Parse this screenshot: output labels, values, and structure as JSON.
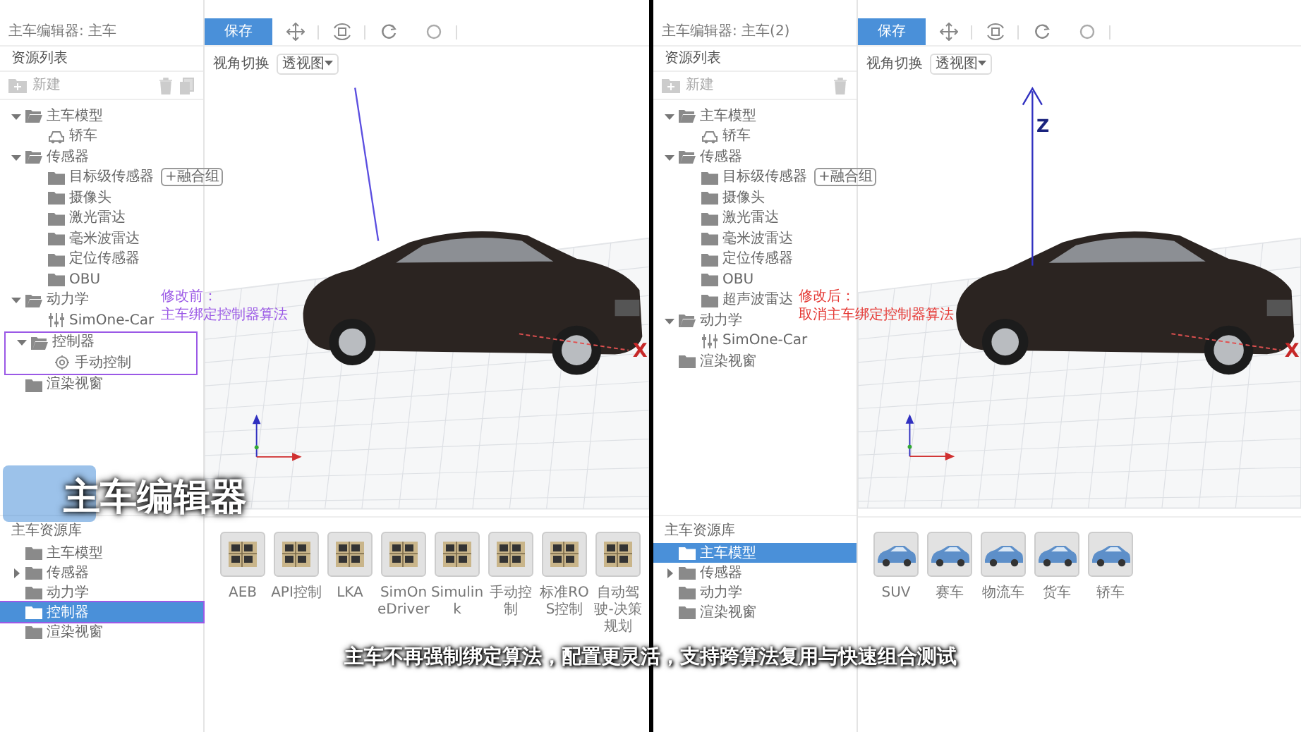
{
  "panes": [
    {
      "editor_title": "主车编辑器: 主车",
      "list_title": "资源列表",
      "new_label": "新建",
      "show_copy": true,
      "tree": [
        {
          "label": "主车模型",
          "kind": "folder",
          "expanded": true,
          "children": [
            {
              "label": "轿车",
              "kind": "car"
            }
          ]
        },
        {
          "label": "传感器",
          "kind": "folder",
          "expanded": true,
          "children": [
            {
              "label": "目标级传感器",
              "kind": "folder",
              "badge": "+融合组"
            },
            {
              "label": "摄像头",
              "kind": "folder"
            },
            {
              "label": "激光雷达",
              "kind": "folder"
            },
            {
              "label": "毫米波雷达",
              "kind": "folder"
            },
            {
              "label": "定位传感器",
              "kind": "folder"
            },
            {
              "label": "OBU",
              "kind": "folder"
            }
          ]
        },
        {
          "label": "动力学",
          "kind": "folder",
          "expanded": true,
          "children": [
            {
              "label": "SimOne-Car",
              "kind": "dynamics"
            }
          ]
        },
        {
          "label": "控制器",
          "kind": "folder",
          "expanded": true,
          "outlined": true,
          "children": [
            {
              "label": "手动控制",
              "kind": "controller"
            }
          ]
        },
        {
          "label": "渲染视窗",
          "kind": "folder"
        }
      ],
      "save_label": "保存",
      "view_label": "视角切换",
      "view_value": "透视图",
      "axes": [
        {
          "kind": "x",
          "label": "X"
        }
      ],
      "annotation": {
        "lines": [
          "修改前：",
          "主车绑定控制器算法"
        ],
        "color": "#9b59e6"
      },
      "library_title": "主车资源库",
      "library": [
        {
          "label": "主车模型",
          "kind": "folder",
          "selected": false,
          "outlined": false
        },
        {
          "label": "传感器",
          "kind": "folder",
          "selected": false,
          "outlined": false,
          "collapsed": true
        },
        {
          "label": "动力学",
          "kind": "folder",
          "selected": false,
          "outlined": false
        },
        {
          "label": "控制器",
          "kind": "folder",
          "selected": true,
          "outlined": true
        },
        {
          "label": "渲染视窗",
          "kind": "folder",
          "selected": false,
          "outlined": false
        }
      ],
      "assets": [
        {
          "label": "AEB",
          "kind": "controller"
        },
        {
          "label": "API控制",
          "kind": "controller"
        },
        {
          "label": "LKA",
          "kind": "controller"
        },
        {
          "label": "SimOneDriver",
          "kind": "controller"
        },
        {
          "label": "Simulink",
          "kind": "controller"
        },
        {
          "label": "手动控制",
          "kind": "controller"
        },
        {
          "label": "标准ROS控制",
          "kind": "controller"
        },
        {
          "label": "自动驾驶-决策规划",
          "kind": "controller"
        }
      ]
    },
    {
      "editor_title": "主车编辑器: 主车(2)",
      "list_title": "资源列表",
      "new_label": "新建",
      "show_copy": false,
      "tree": [
        {
          "label": "主车模型",
          "kind": "folder",
          "expanded": true,
          "children": [
            {
              "label": "轿车",
              "kind": "car"
            }
          ]
        },
        {
          "label": "传感器",
          "kind": "folder",
          "expanded": true,
          "children": [
            {
              "label": "目标级传感器",
              "kind": "folder",
              "badge": "+融合组"
            },
            {
              "label": "摄像头",
              "kind": "folder"
            },
            {
              "label": "激光雷达",
              "kind": "folder"
            },
            {
              "label": "毫米波雷达",
              "kind": "folder"
            },
            {
              "label": "定位传感器",
              "kind": "folder"
            },
            {
              "label": "OBU",
              "kind": "folder"
            },
            {
              "label": "超声波雷达",
              "kind": "folder"
            }
          ]
        },
        {
          "label": "动力学",
          "kind": "folder",
          "expanded": true,
          "children": [
            {
              "label": "SimOne-Car",
              "kind": "dynamics"
            }
          ]
        },
        {
          "label": "渲染视窗",
          "kind": "folder"
        }
      ],
      "save_label": "保存",
      "view_label": "视角切换",
      "view_value": "透视图",
      "axes": [
        {
          "kind": "z",
          "label": "Z"
        },
        {
          "kind": "x",
          "label": "X"
        }
      ],
      "annotation": {
        "lines": [
          "修改后：",
          "取消主车绑定控制器算法"
        ],
        "color": "#e53935"
      },
      "library_title": "主车资源库",
      "library": [
        {
          "label": "主车模型",
          "kind": "folder",
          "selected": true,
          "outlined": false
        },
        {
          "label": "传感器",
          "kind": "folder",
          "selected": false,
          "outlined": false,
          "collapsed": true
        },
        {
          "label": "动力学",
          "kind": "folder",
          "selected": false,
          "outlined": false
        },
        {
          "label": "渲染视窗",
          "kind": "folder",
          "selected": false,
          "outlined": false
        }
      ],
      "assets": [
        {
          "label": "SUV",
          "kind": "vehicle"
        },
        {
          "label": "赛车",
          "kind": "vehicle"
        },
        {
          "label": "物流车",
          "kind": "vehicle"
        },
        {
          "label": "货车",
          "kind": "vehicle"
        },
        {
          "label": "轿车",
          "kind": "vehicle"
        }
      ]
    }
  ],
  "overlay_title": "主车编辑器",
  "subtitle": "主车不再强制绑定算法，配置更灵活，支持跨算法复用与快速组合测试"
}
